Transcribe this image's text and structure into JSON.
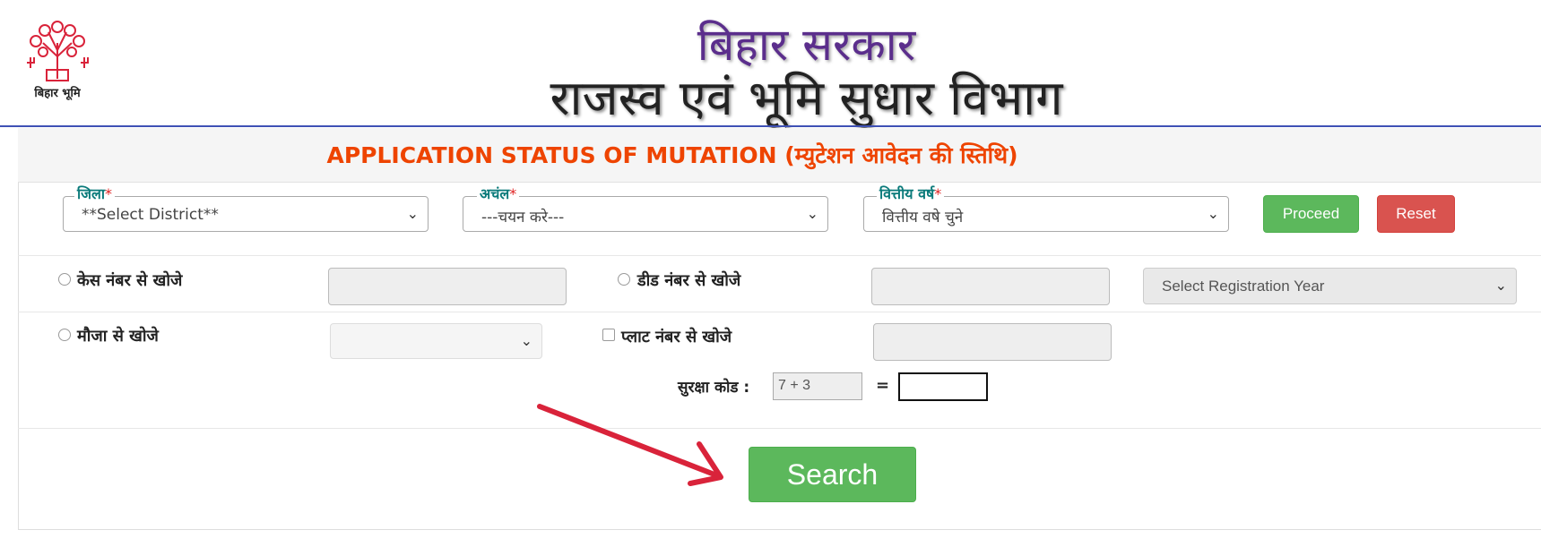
{
  "header": {
    "logo_caption": "बिहार भूमि",
    "title_line1": "बिहार सरकार",
    "title_line2": "राजस्व एवं भूमि सुधार विभाग"
  },
  "panel": {
    "title": "APPLICATION STATUS OF MUTATION (म्युटेशन आवेदन की स्तिथि)"
  },
  "filters": {
    "district": {
      "label": "जिला",
      "required_mark": "*",
      "value": "**Select District**"
    },
    "anchal": {
      "label": "अचंल",
      "required_mark": "*",
      "value": "---चयन करे---"
    },
    "fin_year": {
      "label": "वित्तीय वर्ष",
      "required_mark": "*",
      "value": "वित्तीय वषे चुने"
    },
    "proceed_label": "Proceed",
    "reset_label": "Reset"
  },
  "search_options": {
    "case_label": "केस नंबर से खोजे",
    "deed_label": "डीड नंबर से खोजे",
    "reg_year_placeholder": "Select Registration Year",
    "mauja_label": "मौजा से खोजे",
    "plot_label": "प्लाट नंबर से खोजे"
  },
  "captcha": {
    "label": "सुरक्षा कोड :",
    "question": "7 + 3",
    "equals": "="
  },
  "search_label": "Search",
  "colors": {
    "title_purple": "#5b2e8c",
    "panel_title_orange": "#ee4400",
    "label_teal": "#0a7a7a",
    "green": "#5cb85c",
    "red": "#d9534f",
    "arrow_red": "#d9233a"
  }
}
